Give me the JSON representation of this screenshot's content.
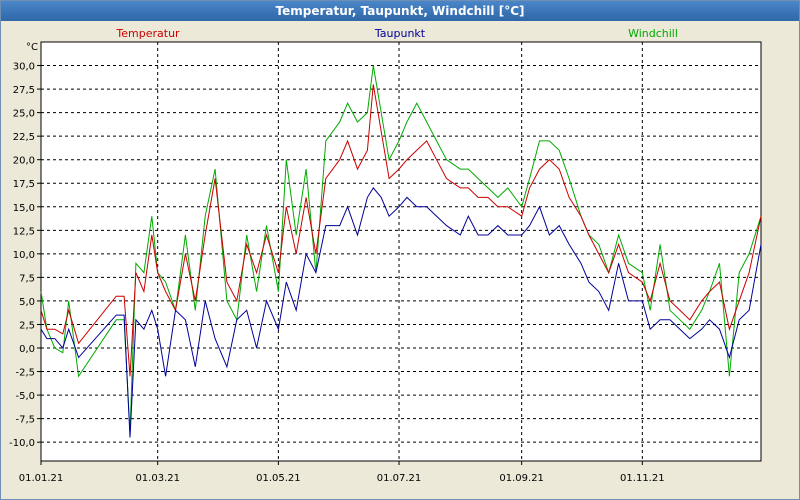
{
  "window": {
    "title": "Temperatur, Taupunkt, Windchill [°C]"
  },
  "chart_data": {
    "type": "line",
    "title": "Temperatur, Taupunkt, Windchill [°C]",
    "ylabel": "°C",
    "ylim": [
      -12,
      32.5
    ],
    "yticks": [
      -10,
      -7.5,
      -5,
      -2.5,
      0,
      2.5,
      5,
      7.5,
      10,
      12.5,
      15,
      17.5,
      20,
      22.5,
      25,
      27.5,
      30
    ],
    "ytick_labels": [
      "-10,0",
      "-7,5",
      "-5,0",
      "-2,5",
      "0,0",
      "2,5",
      "5,0",
      "7,5",
      "10,0",
      "12,5",
      "15,0",
      "17,5",
      "20,0",
      "22,5",
      "25,0",
      "27,5",
      "30,0"
    ],
    "xlim": [
      "2021-01-01",
      "2021-12-31"
    ],
    "xticks": [
      "2021-01-01",
      "2021-03-01",
      "2021-05-01",
      "2021-07-01",
      "2021-09-01",
      "2021-11-01"
    ],
    "xtick_labels": [
      "01.01.21",
      "01.03.21",
      "01.05.21",
      "01.07.21",
      "01.09.21",
      "01.11.21"
    ],
    "grid": true,
    "legend_position": "top",
    "x": [
      "2021-01-01",
      "2021-01-04",
      "2021-01-08",
      "2021-01-12",
      "2021-01-15",
      "2021-01-20",
      "2021-02-08",
      "2021-02-12",
      "2021-02-15",
      "2021-02-18",
      "2021-02-22",
      "2021-02-26",
      "2021-03-01",
      "2021-03-05",
      "2021-03-10",
      "2021-03-15",
      "2021-03-20",
      "2021-03-25",
      "2021-03-30",
      "2021-04-05",
      "2021-04-10",
      "2021-04-15",
      "2021-04-20",
      "2021-04-25",
      "2021-05-01",
      "2021-05-05",
      "2021-05-10",
      "2021-05-15",
      "2021-05-20",
      "2021-05-25",
      "2021-06-01",
      "2021-06-05",
      "2021-06-10",
      "2021-06-15",
      "2021-06-18",
      "2021-06-22",
      "2021-06-26",
      "2021-07-01",
      "2021-07-05",
      "2021-07-10",
      "2021-07-15",
      "2021-07-20",
      "2021-07-25",
      "2021-08-01",
      "2021-08-05",
      "2021-08-10",
      "2021-08-15",
      "2021-08-20",
      "2021-08-25",
      "2021-09-01",
      "2021-09-05",
      "2021-09-10",
      "2021-09-15",
      "2021-09-20",
      "2021-09-25",
      "2021-10-01",
      "2021-10-05",
      "2021-10-10",
      "2021-10-15",
      "2021-10-20",
      "2021-10-25",
      "2021-11-01",
      "2021-11-05",
      "2021-11-10",
      "2021-11-15",
      "2021-11-20",
      "2021-11-25",
      "2021-12-01",
      "2021-12-05",
      "2021-12-10",
      "2021-12-15",
      "2021-12-20",
      "2021-12-25",
      "2021-12-31"
    ],
    "series": [
      {
        "name": "Temperatur",
        "color": "#cc0000",
        "values": [
          4,
          2,
          2,
          1.5,
          4,
          0.5,
          5.5,
          5.5,
          -3,
          8,
          6,
          12,
          8,
          6,
          4,
          10,
          5,
          12,
          18,
          7,
          5,
          11,
          8,
          12,
          8,
          15,
          10,
          16,
          10,
          18,
          20,
          22,
          19,
          21,
          28,
          23,
          18,
          19,
          20,
          21,
          22,
          20,
          18,
          17,
          17,
          16,
          16,
          15,
          15,
          14,
          17,
          19,
          20,
          19,
          16,
          14,
          12,
          10,
          8,
          11,
          8,
          7,
          5,
          9,
          5,
          4,
          3,
          5,
          6,
          7,
          2,
          5,
          8,
          14
        ]
      },
      {
        "name": "Taupunkt",
        "color": "#000099",
        "values": [
          2,
          1,
          1,
          0,
          2,
          -1,
          3.5,
          3.5,
          -9.5,
          3,
          2,
          4,
          2,
          -3,
          4,
          3,
          -2,
          5,
          1,
          -2,
          3,
          4,
          0,
          5,
          2,
          7,
          4,
          10,
          8,
          13,
          13,
          15,
          12,
          16,
          17,
          16,
          14,
          15,
          16,
          15,
          15,
          14,
          13,
          12,
          14,
          12,
          12,
          13,
          12,
          12,
          13,
          15,
          12,
          13,
          11,
          9,
          7,
          6,
          4,
          9,
          5,
          5,
          2,
          3,
          3,
          2,
          1,
          2,
          3,
          2,
          -1,
          3,
          4,
          11
        ]
      },
      {
        "name": "Windchill",
        "color": "#00aa00",
        "values": [
          6,
          2,
          0,
          -0.5,
          5,
          -3,
          3,
          3,
          -9,
          9,
          8,
          14,
          8,
          7,
          4,
          12,
          4,
          14,
          19,
          5,
          3,
          12,
          6,
          13,
          6,
          20,
          12,
          19,
          8,
          22,
          24,
          26,
          24,
          25,
          30,
          25,
          20,
          22,
          24,
          26,
          24,
          22,
          20,
          19,
          19,
          18,
          17,
          16,
          17,
          15,
          18,
          22,
          22,
          21,
          18,
          14,
          12,
          11,
          8,
          12,
          9,
          8,
          4,
          11,
          4,
          3,
          2,
          4,
          6,
          9,
          -3,
          8,
          10,
          14
        ]
      }
    ]
  }
}
